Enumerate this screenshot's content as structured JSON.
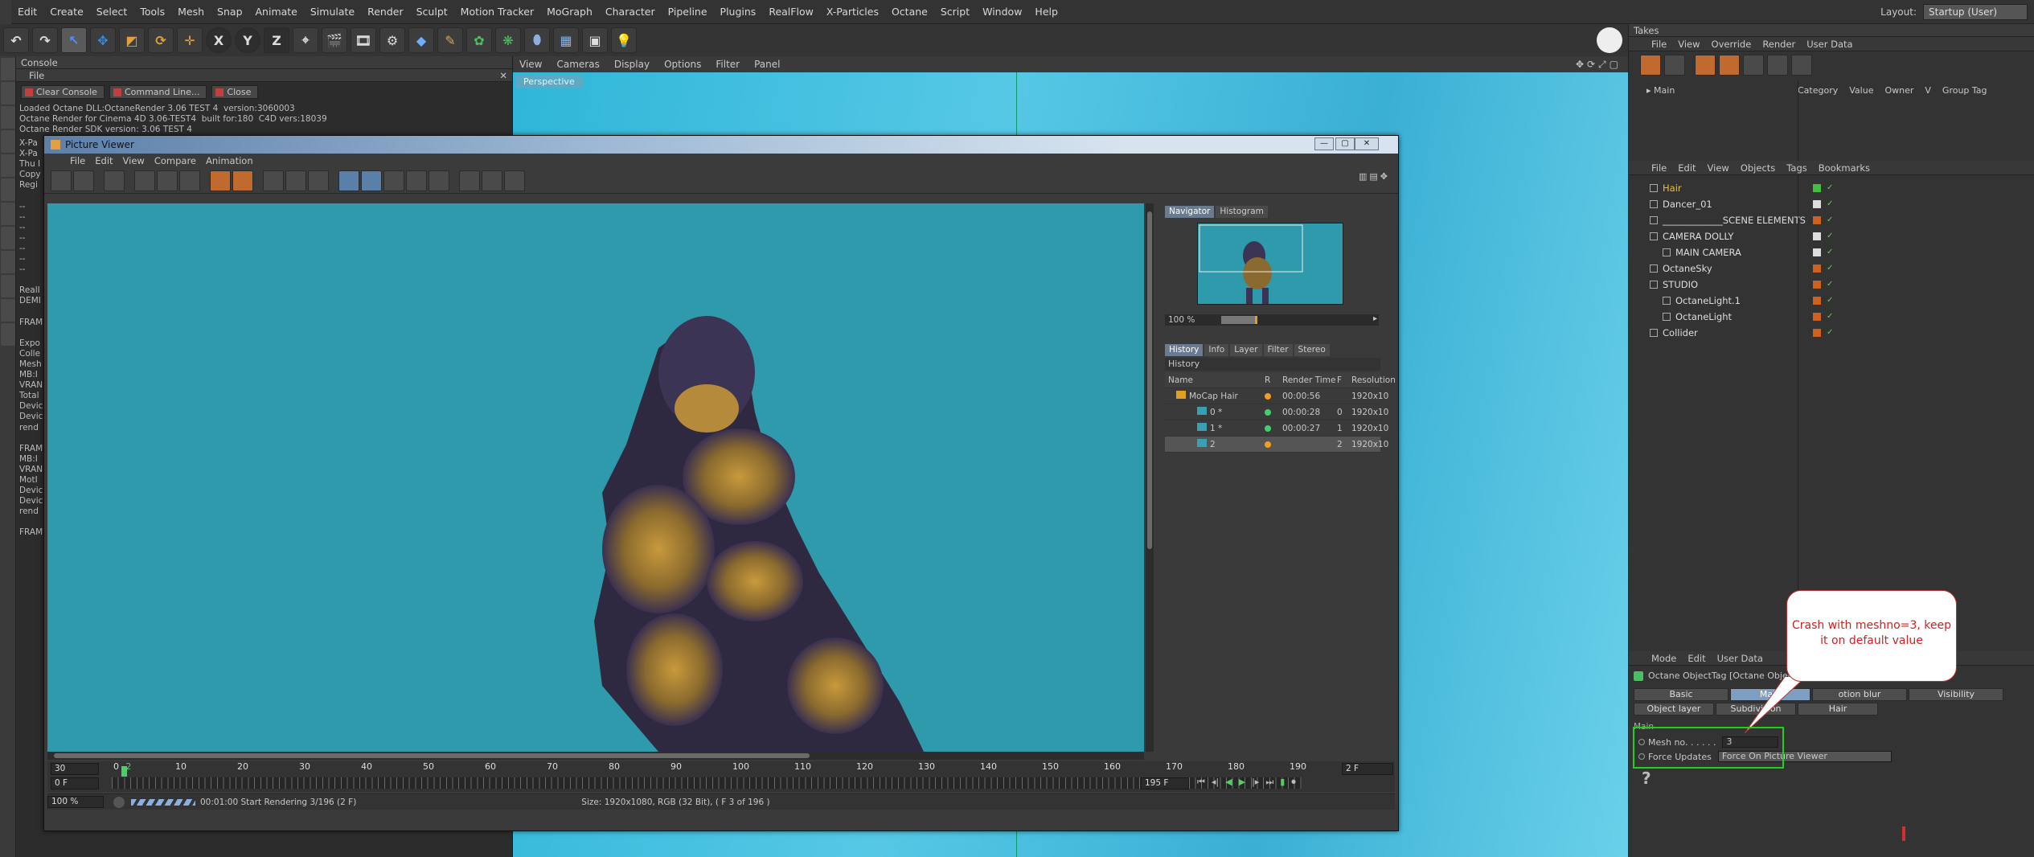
{
  "menubar": {
    "items": [
      "Edit",
      "Create",
      "Select",
      "Tools",
      "Mesh",
      "Snap",
      "Animate",
      "Simulate",
      "Render",
      "Sculpt",
      "Motion Tracker",
      "MoGraph",
      "Character",
      "Pipeline",
      "Plugins",
      "RealFlow",
      "X-Particles",
      "Octane",
      "Script",
      "Window",
      "Help"
    ],
    "layout_label": "Layout:",
    "layout_value": "Startup (User)"
  },
  "toolbar": {
    "x": "X",
    "y": "Y",
    "z": "Z"
  },
  "console": {
    "title": "Console",
    "menu_file": "File",
    "clear": "Clear Console",
    "cmdline": "Command Line...",
    "close": "Close",
    "log": "Loaded Octane DLL:OctaneRender 3.06 TEST 4  version:3060003\nOctane Render for Cinema 4D 3.06-TEST4  built for:180  C4D vers:18039\nOctane Render SDK version: 3.06 TEST 4",
    "side_lines": [
      "X-Pa",
      "X-Pa",
      "Thu I",
      "Copy",
      "Regi",
      "",
      "--",
      "--",
      "--",
      "--",
      "--",
      "--",
      "--",
      "",
      "RealI",
      "DEMI",
      "",
      "FRAM",
      "",
      "Expo",
      "Colle",
      "Mesh",
      "MB:I",
      "VRAN",
      "Total",
      "Devic",
      "Devic",
      "rend",
      "",
      "FRAM",
      "MB:I",
      "VRAN",
      "MotI",
      "Devic",
      "Devic",
      "rend",
      "",
      "FRAM"
    ]
  },
  "viewport": {
    "menu": [
      "View",
      "Cameras",
      "Display",
      "Options",
      "Filter",
      "Panel"
    ],
    "label": "Perspective"
  },
  "picture_viewer": {
    "title": "Picture Viewer",
    "menu": [
      "File",
      "Edit",
      "View",
      "Compare",
      "Animation"
    ],
    "tabs_top": [
      "Navigator",
      "Histogram"
    ],
    "zoom": "100 %",
    "tabs_mid": [
      "History",
      "Info",
      "Layer",
      "Filter",
      "Stereo"
    ],
    "history_title": "History",
    "columns": [
      "Name",
      "R",
      "Render Time",
      "F",
      "Resolution"
    ],
    "rows": [
      {
        "name": "MoCap Hair",
        "time": "00:00:56",
        "f": "",
        "res": "1920x10",
        "dot": "#f0a020"
      },
      {
        "name": "0 *",
        "time": "00:00:28",
        "f": "0",
        "res": "1920x10",
        "dot": "#40d070"
      },
      {
        "name": "1 *",
        "time": "00:00:27",
        "f": "1",
        "res": "1920x10",
        "dot": "#40d070"
      },
      {
        "name": "2",
        "time": "",
        "f": "2",
        "res": "1920x10",
        "dot": "#f0a020"
      }
    ],
    "tl_left_top": "30",
    "tl_left_bottom": "0 F",
    "tl_right_top": "2 F",
    "tl_frame": "195 F",
    "tl_end": "195 F",
    "ruler": [
      "0",
      "2",
      "10",
      "20",
      "30",
      "40",
      "50",
      "60",
      "70",
      "80",
      "90",
      "100",
      "110",
      "120",
      "130",
      "140",
      "150",
      "160",
      "170",
      "180",
      "190"
    ],
    "zoom_status": "100 %",
    "status": "00:01:00 Start Rendering 3/196 (2 F)",
    "size": "Size: 1920x1080, RGB (32 Bit),  ( F 3 of 196 )"
  },
  "takes": {
    "title": "Takes",
    "menu": [
      "File",
      "View",
      "Override",
      "Render",
      "User Data"
    ],
    "main": "Main",
    "cols": [
      "Category",
      "Value",
      "Owner",
      "V",
      "Group Tag"
    ]
  },
  "objects": {
    "menu": [
      "File",
      "Edit",
      "View",
      "Objects",
      "Tags",
      "Bookmarks"
    ],
    "items": [
      {
        "name": "Hair",
        "c": "#f0c030",
        "ind": 12
      },
      {
        "name": "Dancer_01",
        "c": "#ddd",
        "ind": 12
      },
      {
        "name": "_____________SCENE ELEMENTS",
        "c": "#ddd",
        "ind": 12
      },
      {
        "name": "CAMERA DOLLY",
        "c": "#ddd",
        "ind": 12
      },
      {
        "name": "MAIN CAMERA",
        "c": "#ddd",
        "ind": 28
      },
      {
        "name": "OctaneSky",
        "c": "#ddd",
        "ind": 12
      },
      {
        "name": "STUDIO",
        "c": "#ddd",
        "ind": 12
      },
      {
        "name": "OctaneLight.1",
        "c": "#ddd",
        "ind": 28
      },
      {
        "name": "OctaneLight",
        "c": "#ddd",
        "ind": 28
      },
      {
        "name": "Collider",
        "c": "#ddd",
        "ind": 12
      }
    ]
  },
  "attributes": {
    "menu": [
      "Mode",
      "Edit",
      "User Data"
    ],
    "tag": "Octane ObjectTag [Octane Object]",
    "tabs": [
      "Basic",
      "Main",
      "otion blur",
      "Visibility",
      "Object layer",
      "Subdivision",
      "Hair"
    ],
    "section": "Main",
    "mesh_label": "Mesh no. . . . . .",
    "mesh_value": "3",
    "force_label": "Force Updates",
    "force_value": "Force On Picture Viewer",
    "help": "?"
  },
  "callout": {
    "text": "Crash with meshno=3, keep it on default value"
  }
}
